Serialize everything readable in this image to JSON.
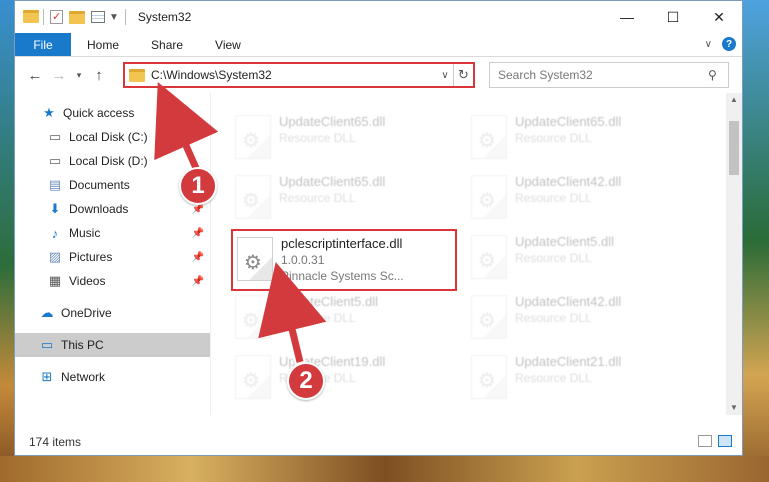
{
  "window": {
    "title": "System32",
    "minimize_glyph": "—",
    "maximize_glyph": "☐",
    "close_glyph": "✕"
  },
  "ribbon": {
    "tabs": [
      "File",
      "Home",
      "Share",
      "View"
    ],
    "help_label": "?"
  },
  "address": {
    "path": "C:\\Windows\\System32",
    "search_placeholder": "Search System32"
  },
  "sidebar": {
    "items": [
      {
        "label": "Quick access",
        "icon": "star-icon",
        "pinned": false
      },
      {
        "label": "Local Disk (C:)",
        "icon": "drive-icon",
        "pinned": true
      },
      {
        "label": "Local Disk (D:)",
        "icon": "drive-icon",
        "pinned": false
      },
      {
        "label": "Documents",
        "icon": "documents-icon",
        "pinned": false
      },
      {
        "label": "Downloads",
        "icon": "download-icon",
        "pinned": true
      },
      {
        "label": "Music",
        "icon": "music-icon",
        "pinned": true
      },
      {
        "label": "Pictures",
        "icon": "pictures-icon",
        "pinned": true
      },
      {
        "label": "Videos",
        "icon": "videos-icon",
        "pinned": true
      },
      {
        "label": "OneDrive",
        "icon": "cloud-icon",
        "pinned": false
      },
      {
        "label": "This PC",
        "icon": "computer-icon",
        "pinned": false,
        "selected": true
      },
      {
        "label": "Network",
        "icon": "network-icon",
        "pinned": false
      }
    ]
  },
  "files": [
    {
      "name": "UpdateClient65.dll",
      "sub": "Resource DLL"
    },
    {
      "name": "UpdateClient65.dll",
      "sub": "Resource DLL"
    },
    {
      "name": "UpdateClient65.dll",
      "sub": "Resource DLL"
    },
    {
      "name": "UpdateClient42.dll",
      "sub": "Resource DLL"
    },
    {
      "name": "pclescriptinterface.dll",
      "sub": "1.0.0.31",
      "sub2": "Pinnacle Systems Sc..."
    },
    {
      "name": "UpdateClient5.dll",
      "sub": "Resource DLL"
    },
    {
      "name": "UpdateClient5.dll",
      "sub": "Resource DLL"
    },
    {
      "name": "UpdateClient42.dll",
      "sub": "Resource DLL"
    },
    {
      "name": "UpdateClient19.dll",
      "sub": "Resource DLL"
    },
    {
      "name": "UpdateClient21.dll",
      "sub": "Resource DLL"
    }
  ],
  "status": {
    "item_count": "174 items"
  },
  "annotations": {
    "badge1": "1",
    "badge2": "2"
  },
  "colors": {
    "accent": "#1979ca",
    "highlight": "#d9353a"
  }
}
